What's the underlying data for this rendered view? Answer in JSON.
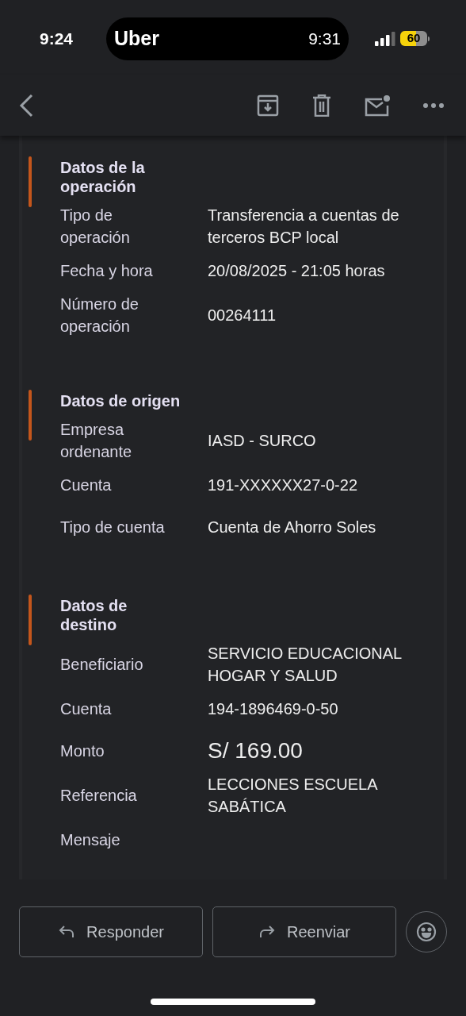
{
  "status_bar": {
    "time": "9:24",
    "activity_app": "Uber",
    "activity_time": "9:31",
    "battery": "60"
  },
  "sections": [
    {
      "title": "Datos de la operación",
      "rows": [
        {
          "label": "Tipo de operación",
          "value": "Transferencia a cuentas de terceros BCP local",
          "kind": "text"
        },
        {
          "label": "Fecha y hora",
          "value": "20/08/2025 - 21:05 horas",
          "kind": "text"
        },
        {
          "label": "Número de operación",
          "value": "00264111",
          "kind": "text"
        }
      ]
    },
    {
      "title": "Datos de origen",
      "rows": [
        {
          "label": "Empresa ordenante",
          "value": "IASD - SURCO",
          "kind": "text"
        },
        {
          "label": "Cuenta",
          "value": "191-XXXXXX27-0-22",
          "kind": "text"
        },
        {
          "label": "Tipo de cuenta",
          "value": "Cuenta de Ahorro Soles",
          "kind": "text"
        }
      ]
    },
    {
      "title": "Datos de destino",
      "rows": [
        {
          "label": "Beneficiario",
          "value": "SERVICIO EDUCACIONAL HOGAR Y SALUD",
          "kind": "text"
        },
        {
          "label": "Cuenta",
          "value": "194-1896469-0-50",
          "kind": "text"
        },
        {
          "label": "Monto",
          "value": "S/ 169.00",
          "kind": "amount"
        },
        {
          "label": "Referencia",
          "value": "LECCIONES ESCUELA SABÁTICA",
          "kind": "text"
        },
        {
          "label": "Mensaje",
          "kind": "text"
        }
      ]
    }
  ],
  "buttons": [
    {
      "label": "Responder",
      "kind": "reply"
    },
    {
      "label": "Reenviar",
      "kind": "forward"
    }
  ]
}
